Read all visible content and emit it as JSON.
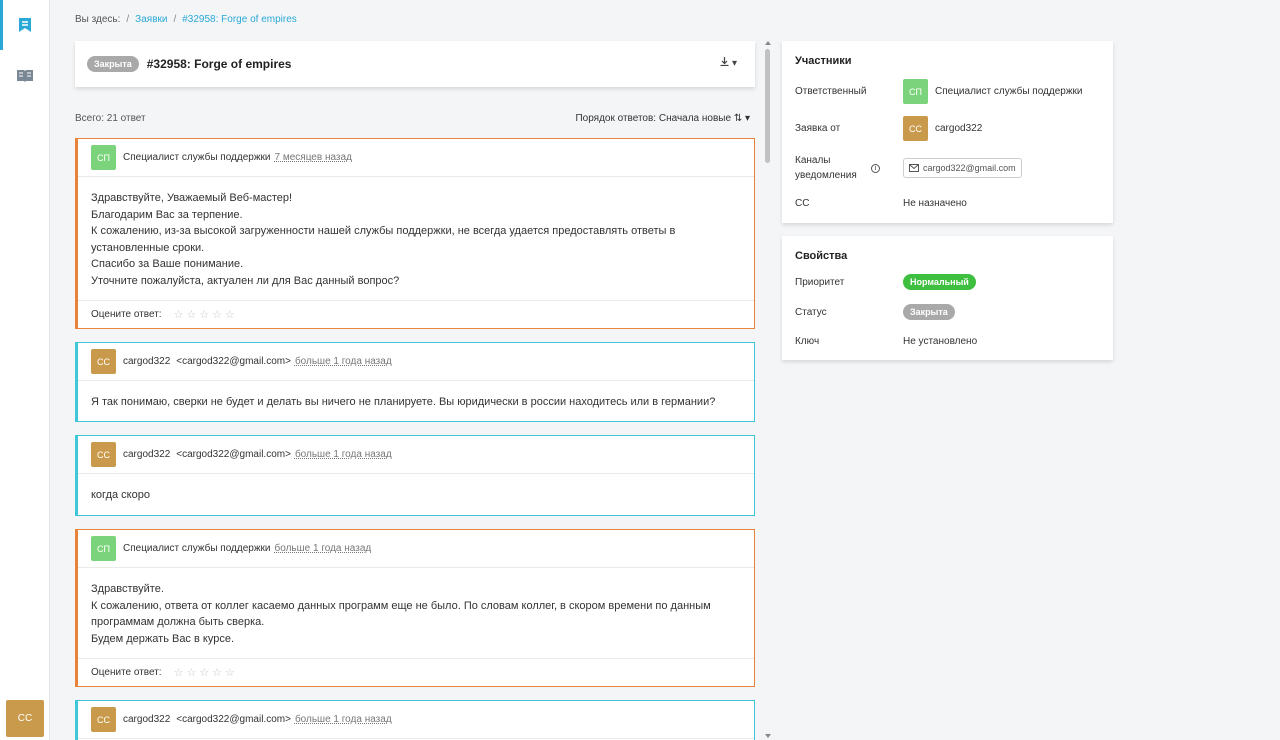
{
  "sidebar": {
    "avatar": "CC"
  },
  "breadcrumb": {
    "prefix": "Вы здесь:",
    "sep1": "/",
    "link1": "Заявки",
    "sep2": "/",
    "current": "#32958: Forge of empires"
  },
  "ticket": {
    "status": "Закрыта",
    "title": "#32958: Forge of empires",
    "download_icon": "download-icon"
  },
  "answers": {
    "count": "Всего: 21 ответ",
    "order_label": "Порядок ответов: Сначала новые ⇅ ▾"
  },
  "messages": [
    {
      "avatar": "СП",
      "author": "Специалист службы поддержки",
      "email": "",
      "time": "7 месяцев назад",
      "body": [
        "Здравствуйте, Уважаемый Веб-мастер!",
        "Благодарим Вас за терпение.",
        "К сожалению, из-за высокой загруженности нашей службы поддержки, не всегда удается предоставлять ответы в",
        "установленные сроки.",
        "Спасибо за Ваше понимание.",
        "Уточните пожалуйста, актуален ли для Вас данный вопрос?"
      ],
      "rate_label": "Оцените ответ:",
      "stars": "☆☆☆☆☆"
    },
    {
      "avatar": "CC",
      "author": "cargod322",
      "email": "<cargod322@gmail.com>",
      "time": "больше 1 года назад",
      "body": [
        "Я так понимаю, сверки не будет и делать вы ничего не планируете. Вы юридически в россии находитесь или в германии?"
      ]
    },
    {
      "avatar": "CC",
      "author": "cargod322",
      "email": "<cargod322@gmail.com>",
      "time": "больше 1 года назад",
      "body": [
        "когда скоро"
      ]
    },
    {
      "avatar": "СП",
      "author": "Специалист службы поддержки",
      "email": "",
      "time": "больше 1 года назад",
      "body": [
        "Здравствуйте.",
        "К сожалению, ответа от коллег касаемо данных программ еще не было. По словам коллег, в скором времени по данным",
        "программам должна быть сверка.",
        "Будем держать Вас в курсе."
      ],
      "rate_label": "Оцените ответ:",
      "stars": "☆☆☆☆☆"
    },
    {
      "avatar": "CC",
      "author": "cargod322",
      "email": "<cargod322@gmail.com>",
      "time": "больше 1 года назад",
      "body": []
    }
  ],
  "participants": {
    "title": "Участники",
    "responsible_label": "Ответственный",
    "responsible_avatar": "СП",
    "responsible_name": "Специалист службы поддержки",
    "from_label": "Заявка от",
    "from_avatar": "CC",
    "from_name": "cargod322",
    "channels_label_1": "Каналы",
    "channels_label_2": "уведомления",
    "channel_email": "cargod322@gmail.com",
    "cc_label": "CC",
    "cc_value": "Не назначено"
  },
  "properties": {
    "title": "Свойства",
    "priority_label": "Приоритет",
    "priority_value": "Нормальный",
    "status_label": "Статус",
    "status_value": "Закрыта",
    "key_label": "Ключ",
    "key_value": "Не установлено"
  },
  "colors": {
    "accent": "#2aa9d6",
    "support_border": "#e9823a",
    "user_border": "#41c6d9",
    "support_avatar": "#7bd47b",
    "user_avatar": "#c99a4b",
    "priority_badge": "#3fbf3f",
    "status_badge": "#a9a9a9"
  }
}
